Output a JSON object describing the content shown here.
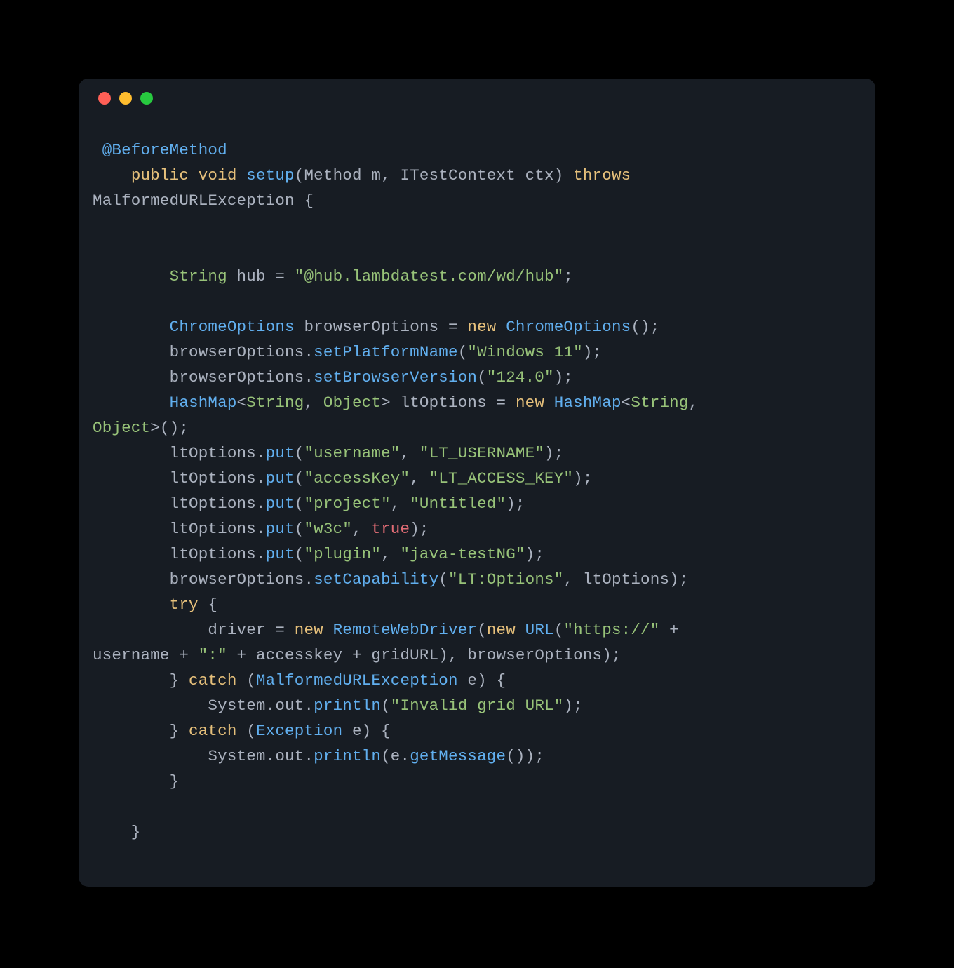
{
  "window": {
    "traffic_lights": {
      "red": "close",
      "yellow": "minimize",
      "green": "zoom"
    }
  },
  "code": {
    "tokens": [
      [
        {
          "t": " ",
          "c": "punc"
        },
        {
          "t": "@BeforeMethod",
          "c": "annotation"
        }
      ],
      [
        {
          "t": "    ",
          "c": "punc"
        },
        {
          "t": "public",
          "c": "keyword"
        },
        {
          "t": " ",
          "c": "punc"
        },
        {
          "t": "void",
          "c": "keyword"
        },
        {
          "t": " ",
          "c": "punc"
        },
        {
          "t": "setup",
          "c": "call"
        },
        {
          "t": "(",
          "c": "punc"
        },
        {
          "t": "Method",
          "c": "type"
        },
        {
          "t": " m, ",
          "c": "punc"
        },
        {
          "t": "ITestContext",
          "c": "type"
        },
        {
          "t": " ctx) ",
          "c": "punc"
        },
        {
          "t": "throws",
          "c": "keyword"
        },
        {
          "t": " ",
          "c": "punc"
        }
      ],
      [
        {
          "t": "MalformedURLException {",
          "c": "type"
        }
      ],
      [
        {
          "t": "",
          "c": "punc"
        }
      ],
      [
        {
          "t": "",
          "c": "punc"
        }
      ],
      [
        {
          "t": "        ",
          "c": "punc"
        },
        {
          "t": "String",
          "c": "ident"
        },
        {
          "t": " hub = ",
          "c": "punc"
        },
        {
          "t": "\"@hub.lambdatest.com/wd/hub\"",
          "c": "string"
        },
        {
          "t": ";",
          "c": "punc"
        }
      ],
      [
        {
          "t": "",
          "c": "punc"
        }
      ],
      [
        {
          "t": "        ",
          "c": "punc"
        },
        {
          "t": "ChromeOptions",
          "c": "call"
        },
        {
          "t": " browserOptions = ",
          "c": "punc"
        },
        {
          "t": "new",
          "c": "new"
        },
        {
          "t": " ",
          "c": "punc"
        },
        {
          "t": "ChromeOptions",
          "c": "call"
        },
        {
          "t": "();",
          "c": "punc"
        }
      ],
      [
        {
          "t": "        browserOptions.",
          "c": "punc"
        },
        {
          "t": "setPlatformName",
          "c": "call"
        },
        {
          "t": "(",
          "c": "punc"
        },
        {
          "t": "\"Windows 11\"",
          "c": "string"
        },
        {
          "t": ");",
          "c": "punc"
        }
      ],
      [
        {
          "t": "        browserOptions.",
          "c": "punc"
        },
        {
          "t": "setBrowserVersion",
          "c": "call"
        },
        {
          "t": "(",
          "c": "punc"
        },
        {
          "t": "\"124.0\"",
          "c": "string"
        },
        {
          "t": ");",
          "c": "punc"
        }
      ],
      [
        {
          "t": "        ",
          "c": "punc"
        },
        {
          "t": "HashMap",
          "c": "call"
        },
        {
          "t": "<",
          "c": "punc"
        },
        {
          "t": "String",
          "c": "ident"
        },
        {
          "t": ", ",
          "c": "punc"
        },
        {
          "t": "Object",
          "c": "ident"
        },
        {
          "t": "> ltOptions = ",
          "c": "punc"
        },
        {
          "t": "new",
          "c": "new"
        },
        {
          "t": " ",
          "c": "punc"
        },
        {
          "t": "HashMap",
          "c": "call"
        },
        {
          "t": "<",
          "c": "punc"
        },
        {
          "t": "String",
          "c": "ident"
        },
        {
          "t": ", ",
          "c": "punc"
        }
      ],
      [
        {
          "t": "Object",
          "c": "ident"
        },
        {
          "t": ">();",
          "c": "punc"
        }
      ],
      [
        {
          "t": "        ltOptions.",
          "c": "punc"
        },
        {
          "t": "put",
          "c": "call"
        },
        {
          "t": "(",
          "c": "punc"
        },
        {
          "t": "\"username\"",
          "c": "string"
        },
        {
          "t": ", ",
          "c": "punc"
        },
        {
          "t": "\"LT_USERNAME\"",
          "c": "string"
        },
        {
          "t": ");",
          "c": "punc"
        }
      ],
      [
        {
          "t": "        ltOptions.",
          "c": "punc"
        },
        {
          "t": "put",
          "c": "call"
        },
        {
          "t": "(",
          "c": "punc"
        },
        {
          "t": "\"accessKey\"",
          "c": "string"
        },
        {
          "t": ", ",
          "c": "punc"
        },
        {
          "t": "\"LT_ACCESS_KEY\"",
          "c": "string"
        },
        {
          "t": ");",
          "c": "punc"
        }
      ],
      [
        {
          "t": "        ltOptions.",
          "c": "punc"
        },
        {
          "t": "put",
          "c": "call"
        },
        {
          "t": "(",
          "c": "punc"
        },
        {
          "t": "\"project\"",
          "c": "string"
        },
        {
          "t": ", ",
          "c": "punc"
        },
        {
          "t": "\"Untitled\"",
          "c": "string"
        },
        {
          "t": ");",
          "c": "punc"
        }
      ],
      [
        {
          "t": "        ltOptions.",
          "c": "punc"
        },
        {
          "t": "put",
          "c": "call"
        },
        {
          "t": "(",
          "c": "punc"
        },
        {
          "t": "\"w3c\"",
          "c": "string"
        },
        {
          "t": ", ",
          "c": "punc"
        },
        {
          "t": "true",
          "c": "bool"
        },
        {
          "t": ");",
          "c": "punc"
        }
      ],
      [
        {
          "t": "        ltOptions.",
          "c": "punc"
        },
        {
          "t": "put",
          "c": "call"
        },
        {
          "t": "(",
          "c": "punc"
        },
        {
          "t": "\"plugin\"",
          "c": "string"
        },
        {
          "t": ", ",
          "c": "punc"
        },
        {
          "t": "\"java-testNG\"",
          "c": "string"
        },
        {
          "t": ");",
          "c": "punc"
        }
      ],
      [
        {
          "t": "        browserOptions.",
          "c": "punc"
        },
        {
          "t": "setCapability",
          "c": "call"
        },
        {
          "t": "(",
          "c": "punc"
        },
        {
          "t": "\"LT:Options\"",
          "c": "string"
        },
        {
          "t": ", ltOptions);",
          "c": "punc"
        }
      ],
      [
        {
          "t": "        ",
          "c": "punc"
        },
        {
          "t": "try",
          "c": "keyword"
        },
        {
          "t": " {",
          "c": "punc"
        }
      ],
      [
        {
          "t": "            driver = ",
          "c": "punc"
        },
        {
          "t": "new",
          "c": "new"
        },
        {
          "t": " ",
          "c": "punc"
        },
        {
          "t": "RemoteWebDriver",
          "c": "call"
        },
        {
          "t": "(",
          "c": "punc"
        },
        {
          "t": "new",
          "c": "new"
        },
        {
          "t": " ",
          "c": "punc"
        },
        {
          "t": "URL",
          "c": "call"
        },
        {
          "t": "(",
          "c": "punc"
        },
        {
          "t": "\"https://\"",
          "c": "string"
        },
        {
          "t": " + ",
          "c": "punc"
        }
      ],
      [
        {
          "t": "username + ",
          "c": "punc"
        },
        {
          "t": "\":\"",
          "c": "string"
        },
        {
          "t": " + accesskey + gridURL), browserOptions);",
          "c": "punc"
        }
      ],
      [
        {
          "t": "        } ",
          "c": "punc"
        },
        {
          "t": "catch",
          "c": "keyword"
        },
        {
          "t": " (",
          "c": "punc"
        },
        {
          "t": "MalformedURLException",
          "c": "call"
        },
        {
          "t": " e) {",
          "c": "punc"
        }
      ],
      [
        {
          "t": "            System.out.",
          "c": "punc"
        },
        {
          "t": "println",
          "c": "call"
        },
        {
          "t": "(",
          "c": "punc"
        },
        {
          "t": "\"Invalid grid URL\"",
          "c": "string"
        },
        {
          "t": ");",
          "c": "punc"
        }
      ],
      [
        {
          "t": "        } ",
          "c": "punc"
        },
        {
          "t": "catch",
          "c": "keyword"
        },
        {
          "t": " (",
          "c": "punc"
        },
        {
          "t": "Exception",
          "c": "call"
        },
        {
          "t": " e) {",
          "c": "punc"
        }
      ],
      [
        {
          "t": "            System.out.",
          "c": "punc"
        },
        {
          "t": "println",
          "c": "call"
        },
        {
          "t": "(e.",
          "c": "punc"
        },
        {
          "t": "getMessage",
          "c": "call"
        },
        {
          "t": "());",
          "c": "punc"
        }
      ],
      [
        {
          "t": "        }",
          "c": "punc"
        }
      ],
      [
        {
          "t": "",
          "c": "punc"
        }
      ],
      [
        {
          "t": "    }",
          "c": "punc"
        }
      ]
    ]
  }
}
